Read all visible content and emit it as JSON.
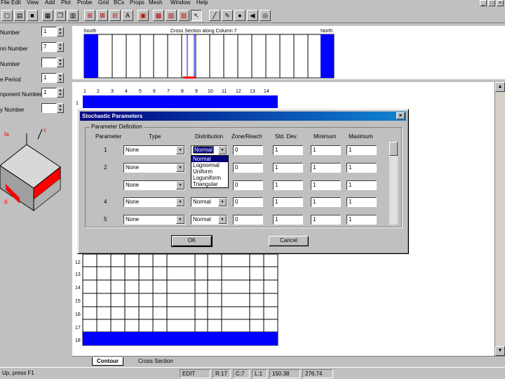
{
  "menu": [
    "File",
    "Edit",
    "View",
    "Add",
    "Plot",
    "Probe",
    "Grid",
    "BCs",
    "Props",
    "Mesh",
    "Window",
    "Help"
  ],
  "window_controls": [
    "_",
    "□",
    "×"
  ],
  "toolbar": {
    "icons": [
      "new-icon",
      "open-icon",
      "save-icon",
      "print-icon",
      "copy-icon",
      "paste-icon",
      "grid-red-icon",
      "grid-red-icon-2",
      "grid-red-icon-3",
      "text-icon",
      "props-icon",
      "props-icon-2",
      "props-icon-3",
      "props-icon-4",
      "pointer-icon",
      "line-icon",
      "pen-icon",
      "circle-icon",
      "arrow-icon",
      "target-icon"
    ]
  },
  "left_panel": {
    "fields": [
      {
        "label": "Number",
        "value": "1"
      },
      {
        "label": "nn Number",
        "value": "7"
      },
      {
        "label": "Number",
        "value": ""
      },
      {
        "label": "e Period",
        "value": "1"
      },
      {
        "label": "nponent Number",
        "value": "1"
      },
      {
        "label": "y Number",
        "value": ""
      }
    ],
    "iso_labels": [
      "fa",
      "c",
      "d"
    ]
  },
  "cross_section": {
    "left_label": "South",
    "center_label": "Cross Section along Column 7",
    "right_label": "North"
  },
  "contour": {
    "column_labels": [
      "1",
      "2",
      "3",
      "4",
      "5",
      "6",
      "7",
      "8",
      "9",
      "10",
      "11",
      "12",
      "13",
      "14"
    ],
    "row_labels": [
      "1",
      "12",
      "13",
      "14",
      "15",
      "16",
      "17",
      "18"
    ]
  },
  "tabs": [
    "Contour",
    "Cross Section"
  ],
  "status": {
    "left": "Up, press F1",
    "mode": "EDIT",
    "row": "R:17",
    "col": "C:7",
    "layer": "L:1",
    "x": "150.38",
    "y": "276.74"
  },
  "dialog": {
    "title": "Stochastic Parameters",
    "group_label": "Parameter Definition",
    "headers": [
      "Parameter",
      "Type",
      "Distribution",
      "Zone/Reach",
      "Std. Dev.",
      "Minimum",
      "Maximum"
    ],
    "rows": [
      {
        "param": "1",
        "type": "None",
        "distribution": "Normal",
        "zone": "0",
        "std": "1",
        "min": "1",
        "max": "1"
      },
      {
        "param": "2",
        "type": "None",
        "distribution": "",
        "zone": "0",
        "std": "1",
        "min": "1",
        "max": "1"
      },
      {
        "param": "",
        "type": "None",
        "distribution": "",
        "zone": "0",
        "std": "1",
        "min": "1",
        "max": "1"
      },
      {
        "param": "4",
        "type": "None",
        "distribution": "Normal",
        "zone": "0",
        "std": "1",
        "min": "1",
        "max": "1"
      },
      {
        "param": "5",
        "type": "None",
        "distribution": "Normal",
        "zone": "0",
        "std": "1",
        "min": "1",
        "max": "1"
      }
    ],
    "dropdown_options": [
      "Normal",
      "Lognormal",
      "Uniform",
      "Loguniform",
      "Triangular"
    ],
    "ok_label": "OK",
    "cancel_label": "Cancel"
  },
  "colors": {
    "accent": "#0000ff",
    "title_bar": "#000080",
    "iso_red": "#ff0000"
  }
}
